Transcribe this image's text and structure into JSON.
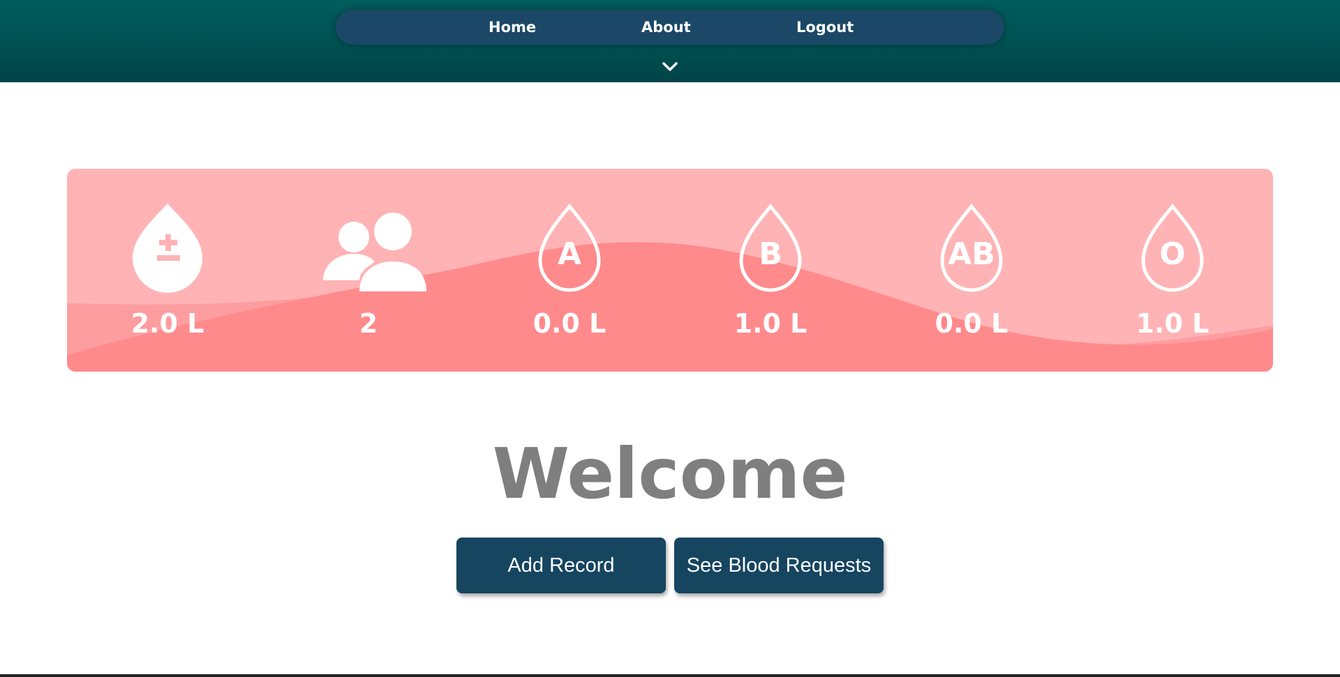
{
  "nav": {
    "items": [
      {
        "label": "Home"
      },
      {
        "label": "About"
      },
      {
        "label": "Logout"
      }
    ],
    "toggle_icon": "chevron-down-icon"
  },
  "stats": [
    {
      "icon": "blood-drop-plus-minus-icon",
      "value": "2.0 L"
    },
    {
      "icon": "users-icon",
      "value": "2"
    },
    {
      "icon": "blood-drop-outline-icon",
      "type_label": "A",
      "value": "0.0 L"
    },
    {
      "icon": "blood-drop-outline-icon",
      "type_label": "B",
      "value": "1.0 L"
    },
    {
      "icon": "blood-drop-outline-icon",
      "type_label": "AB",
      "value": "0.0 L"
    },
    {
      "icon": "blood-drop-outline-icon",
      "type_label": "O",
      "value": "1.0 L"
    }
  ],
  "welcome": {
    "title": "Welcome"
  },
  "actions": {
    "add_record_label": "Add Record",
    "see_requests_label": "See Blood Requests"
  },
  "colors": {
    "header": "#005e5e",
    "nav_pill": "#1a4866",
    "panel_light": "#ffb3b5",
    "panel_mid": "#fd9d9f",
    "panel_dark": "#ff8a8c",
    "button": "#164560",
    "welcome_text": "#7f7f7f"
  }
}
